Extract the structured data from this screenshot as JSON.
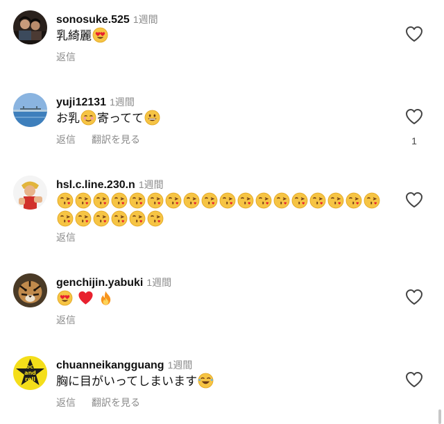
{
  "comments": [
    {
      "username": "sonosuke.525",
      "time": "1週間",
      "text_parts": [
        "乳綺麗"
      ],
      "actions": {
        "reply": "返信"
      },
      "avatar_icon": "person-photo-avatar"
    },
    {
      "username": "yuji12131",
      "time": "1週間",
      "text_parts": [
        "お乳",
        "寄ってて"
      ],
      "actions": {
        "reply": "返信",
        "translate": "翻訳を見る"
      },
      "like_count": "1",
      "avatar_icon": "ocean-photo-avatar"
    },
    {
      "username": "hsl.c.line.230.n",
      "time": "1週間",
      "text_parts": [],
      "emoji_count": 24,
      "actions": {
        "reply": "返信"
      },
      "avatar_icon": "cartoon-fighter-avatar"
    },
    {
      "username": "genchijin.yabuki",
      "time": "1週間",
      "text_parts": [],
      "actions": {
        "reply": "返信"
      },
      "avatar_icon": "tiger-photo-avatar"
    },
    {
      "username": "chuanneikangguang",
      "time": "1週間",
      "text_parts": [
        "胸に目がいってしまいます"
      ],
      "actions": {
        "reply": "返信",
        "translate": "翻訳を見る"
      },
      "avatar_icon": "rock-and-roll-star-avatar",
      "avatar_text": [
        "rock",
        "and",
        "roll"
      ]
    }
  ],
  "colors": {
    "username": "#111111",
    "secondary_text": "#8a8a8a",
    "emoji_face": "#f6c444",
    "heart_red": "#e8212e",
    "fire_orange": "#f7941d"
  }
}
